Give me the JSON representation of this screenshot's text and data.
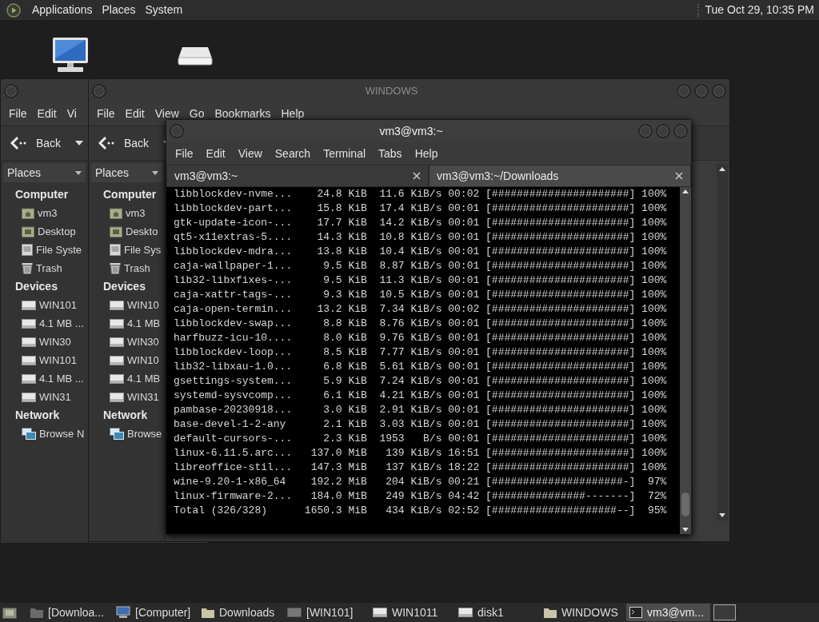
{
  "top_panel": {
    "menus": [
      "Applications",
      "Places",
      "System"
    ],
    "clock": "Tue Oct 29, 10:35 PM"
  },
  "back_window": {
    "menus": [
      "File",
      "Edit",
      "Vi"
    ],
    "back_label": "Back",
    "places_label": "Places",
    "sidebar": [
      {
        "heading": "Computer",
        "items": [
          {
            "label": "vm3",
            "kind": "home"
          },
          {
            "label": "Desktop",
            "kind": "desktop"
          },
          {
            "label": "File Syste",
            "kind": "filesystem"
          },
          {
            "label": "Trash",
            "kind": "trash"
          }
        ]
      },
      {
        "heading": "Devices",
        "items": [
          {
            "label": "WIN101",
            "kind": "drive"
          },
          {
            "label": "4.1 MB ...",
            "kind": "drive"
          },
          {
            "label": "WIN30",
            "kind": "drive"
          },
          {
            "label": "WIN101",
            "kind": "drive"
          },
          {
            "label": "4.1 MB ...",
            "kind": "drive"
          },
          {
            "label": "WIN31",
            "kind": "drive"
          }
        ]
      },
      {
        "heading": "Network",
        "items": [
          {
            "label": "Browse N",
            "kind": "network"
          }
        ]
      }
    ]
  },
  "file_window": {
    "title": "WINDOWS",
    "menus": [
      "File",
      "Edit",
      "View",
      "Go",
      "Bookmarks",
      "Help"
    ],
    "back_label": "Back",
    "places_label": "Places",
    "sidebar": [
      {
        "heading": "Computer",
        "items": [
          {
            "label": "vm3",
            "kind": "home"
          },
          {
            "label": "Deskto",
            "kind": "desktop"
          },
          {
            "label": "File Sys",
            "kind": "filesystem"
          },
          {
            "label": "Trash",
            "kind": "trash"
          }
        ]
      },
      {
        "heading": "Devices",
        "items": [
          {
            "label": "WIN10",
            "kind": "drive"
          },
          {
            "label": "4.1 MB",
            "kind": "drive"
          },
          {
            "label": "WIN30",
            "kind": "drive"
          },
          {
            "label": "WIN10",
            "kind": "drive"
          },
          {
            "label": "4.1 MB",
            "kind": "drive"
          },
          {
            "label": "WIN31",
            "kind": "drive"
          }
        ]
      },
      {
        "heading": "Network",
        "items": [
          {
            "label": "Browse",
            "kind": "network"
          }
        ]
      }
    ]
  },
  "terminal": {
    "title": "vm3@vm3:~",
    "menus": [
      "File",
      "Edit",
      "View",
      "Search",
      "Terminal",
      "Tabs",
      "Help"
    ],
    "tabs": [
      {
        "label": "vm3@vm3:~",
        "selected": true
      },
      {
        "label": "vm3@vm3:~/Downloads",
        "selected": false
      }
    ],
    "lines": [
      "libblockdev-nvme...    24.8 KiB  11.6 KiB/s 00:02 [######################] 100%",
      "libblockdev-part...    15.8 KiB  17.4 KiB/s 00:01 [######################] 100%",
      "gtk-update-icon-...    17.7 KiB  14.2 KiB/s 00:01 [######################] 100%",
      "qt5-x11extras-5....    14.3 KiB  10.8 KiB/s 00:01 [######################] 100%",
      "libblockdev-mdra...    13.8 KiB  10.4 KiB/s 00:01 [######################] 100%",
      "caja-wallpaper-1...     9.5 KiB  8.87 KiB/s 00:01 [######################] 100%",
      "lib32-libxfixes-...     9.5 KiB  11.3 KiB/s 00:01 [######################] 100%",
      "caja-xattr-tags-...     9.3 KiB  10.5 KiB/s 00:01 [######################] 100%",
      "caja-open-termin...    13.2 KiB  7.34 KiB/s 00:02 [######################] 100%",
      "libblockdev-swap...     8.8 KiB  8.76 KiB/s 00:01 [######################] 100%",
      "harfbuzz-icu-10....     8.0 KiB  9.76 KiB/s 00:01 [######################] 100%",
      "libblockdev-loop...     8.5 KiB  7.77 KiB/s 00:01 [######################] 100%",
      "lib32-libxau-1.0...     6.8 KiB  5.61 KiB/s 00:01 [######################] 100%",
      "gsettings-system...     5.9 KiB  7.24 KiB/s 00:01 [######################] 100%",
      "systemd-sysvcomp...     6.1 KiB  4.21 KiB/s 00:01 [######################] 100%",
      "pambase-20230918...     3.0 KiB  2.91 KiB/s 00:01 [######################] 100%",
      "base-devel-1-2-any      2.1 KiB  3.03 KiB/s 00:01 [######################] 100%",
      "default-cursors-...     2.3 KiB  1953   B/s 00:01 [######################] 100%",
      "linux-6.11.5.arc...   137.0 MiB   139 KiB/s 16:51 [######################] 100%",
      "libreoffice-stil...   147.3 MiB   137 KiB/s 18:22 [######################] 100%",
      "wine-9.20-1-x86_64    192.2 MiB   204 KiB/s 00:21 [#####################-]  97%",
      "linux-firmware-2...   184.0 MiB   249 KiB/s 04:42 [###############-------]  72%",
      "Total (326/328)      1650.3 MiB   434 KiB/s 02:52 [####################--]  95%"
    ]
  },
  "taskbar": {
    "items": [
      {
        "label": "[Downloa...",
        "kind": "folder-dark",
        "selected": false
      },
      {
        "label": "[Computer]",
        "kind": "computer",
        "selected": false
      },
      {
        "label": "Downloads",
        "kind": "folder",
        "selected": false
      },
      {
        "label": "[WIN101]",
        "kind": "drive-dark",
        "selected": false
      },
      {
        "label": "WIN1011",
        "kind": "drive",
        "selected": false
      },
      {
        "label": "disk1",
        "kind": "drive",
        "selected": false
      },
      {
        "label": "WINDOWS",
        "kind": "folder",
        "selected": false
      },
      {
        "label": "vm3@vm...",
        "kind": "terminal",
        "selected": true
      }
    ]
  }
}
